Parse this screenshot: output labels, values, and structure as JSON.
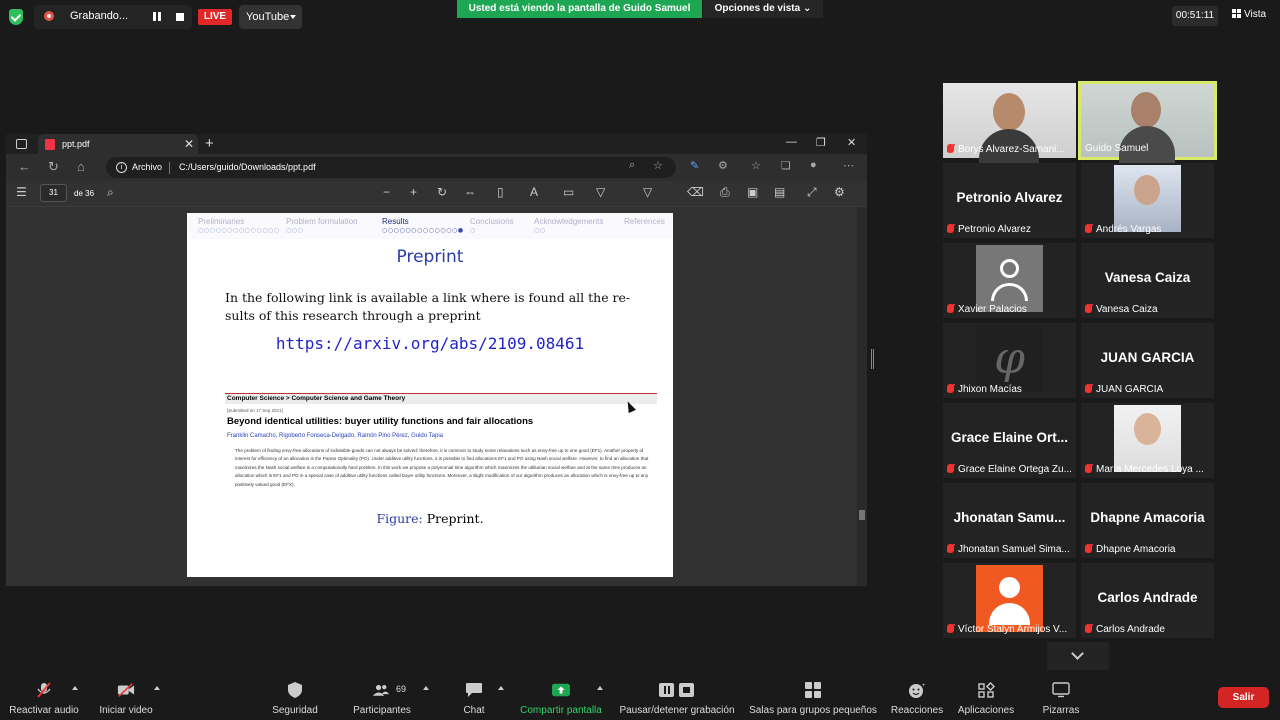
{
  "topbar": {
    "recording_label": "Grabando...",
    "live_label": "LIVE",
    "stream_target": "YouTube",
    "viewing_banner": "Usted está viendo la pantalla de Guido Samuel",
    "view_options": "Opciones de vista",
    "timer": "00:51:11",
    "view_label": "Vista"
  },
  "browser": {
    "tab_title": "ppt.pdf",
    "address_label": "Archivo",
    "url": "C:/Users/guido/Downloads/ppt.pdf",
    "page_number": "31",
    "page_total": "de 36"
  },
  "slide": {
    "nav": [
      {
        "label": "Preliminaries",
        "dots": "○○○○○○○○○○○○○○"
      },
      {
        "label": "Problem formulation",
        "dots": "○○○"
      },
      {
        "label": "Results",
        "dots": "○○○○○○○○○○○○○●"
      },
      {
        "label": "Conclusions",
        "dots": "○"
      },
      {
        "label": "Acknowledgements",
        "dots": "○○"
      },
      {
        "label": "References",
        "dots": ""
      }
    ],
    "title": "Preprint",
    "body": "In the following link is available a link where is found all the re- sults of this research through a preprint",
    "link": "https://arxiv.org/abs/2109.08461",
    "arxiv": {
      "breadcrumb": "Computer Science > Computer Science and Game Theory",
      "submitted": "[Submitted on 17 Sep 2021]",
      "title": "Beyond identical utilities: buyer utility functions and fair allocations",
      "authors": "Franklin Camacho, Rigoberto Fonseca-Delgado, Ramón Pino Pérez, Guido Tapia",
      "abstract": "The problem of finding envy-free allocations of indivisible goods can not always be solved; therefore, it is common to study some relaxations such as envy-free up to one good (EF1). Another property of interest for efficiency of an allocation is the Pareto Optimality (PO). Under additive utility functions, it is possible to find allocations EF1 and PO using Nash social welfare. However, to find an allocation that maximizes the Nash social welfare is a computationally hard problem. In this work we propose a polynomial time algorithm which maximizes the utilitarian social welfare and at the same time produces an allocation which is EF1 and PO in a special case of additive utility functions called buyer utility functions. Moreover, a slight modification of our algorithm produces an allocation which is envy-free up to any positively valued good (EFX)."
    },
    "figure_label": "Figure:",
    "figure_caption": "Preprint."
  },
  "participants": [
    {
      "name": "Borys Alvarez-Samani...",
      "kind": "video"
    },
    {
      "name": "Guido Samuel",
      "kind": "video",
      "active": true
    },
    {
      "name": "Petronio Alvarez",
      "kind": "text",
      "big": "Petronio Alvarez"
    },
    {
      "name": "Andrés Vargas",
      "kind": "photo"
    },
    {
      "name": "Xavier Palacios",
      "kind": "avatar-gray"
    },
    {
      "name": "Vanesa Caiza",
      "kind": "text",
      "big": "Vanesa Caiza"
    },
    {
      "name": "Jhixon Macías",
      "kind": "phi"
    },
    {
      "name": "JUAN GARCIA",
      "kind": "text",
      "big": "JUAN GARCIA"
    },
    {
      "name": "Grace Elaine Ortega Zu...",
      "kind": "text",
      "big": "Grace Elaine Ort..."
    },
    {
      "name": "María Mercedes Loya ...",
      "kind": "photo"
    },
    {
      "name": "Jhonatan Samuel Sima...",
      "kind": "text",
      "big": "Jhonatan Samu..."
    },
    {
      "name": "Dhapne Amacoria",
      "kind": "text",
      "big": "Dhapne Amacoria"
    },
    {
      "name": "Víctor Stalyn Armijos V...",
      "kind": "avatar-orange"
    },
    {
      "name": "Carlos Andrade",
      "kind": "text",
      "big": "Carlos Andrade"
    }
  ],
  "toolbar": {
    "unmute": "Reactivar audio",
    "start_video": "Iniciar video",
    "security": "Seguridad",
    "participants": "Participantes",
    "participants_count": "69",
    "chat": "Chat",
    "share": "Compartir pantalla",
    "pause_recording": "Pausar/detener grabación",
    "breakout": "Salas para grupos pequeños",
    "reactions": "Reacciones",
    "apps": "Aplicaciones",
    "whiteboards": "Pizarras",
    "leave": "Salir"
  },
  "colors": {
    "banner_green": "#1ea753",
    "live_red": "#e02828",
    "active_speaker": "#d9e96a",
    "slide_blue": "#2a3aa8",
    "leave_red": "#d42525"
  }
}
